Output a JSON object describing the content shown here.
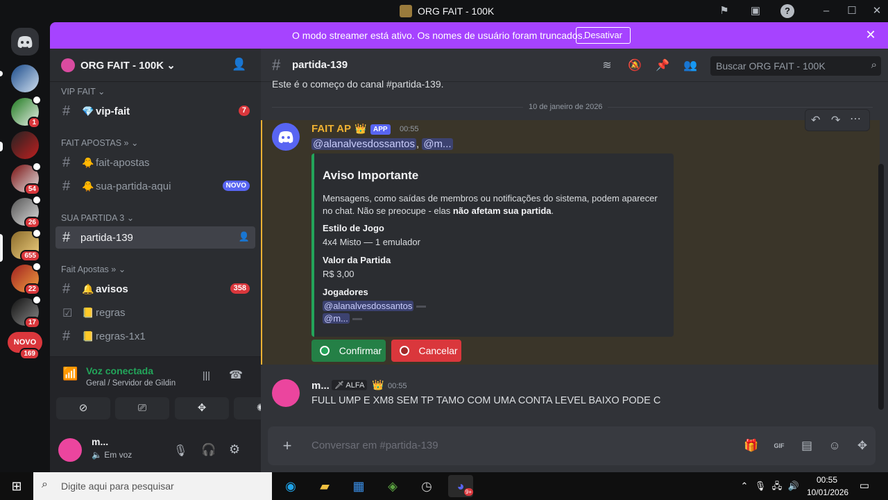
{
  "window": {
    "title": "ORG FAIT - 100K"
  },
  "banner": {
    "text": "O modo streamer está ativo. Os nomes de usuário foram truncados.",
    "button": "Desativar"
  },
  "servers": [
    {
      "badge": ""
    },
    {
      "badge": "1"
    },
    {
      "badge": ""
    },
    {
      "badge": "54"
    },
    {
      "badge": "26"
    },
    {
      "badge": "655"
    },
    {
      "badge": "22"
    },
    {
      "badge": "17"
    },
    {
      "label": "NOVO",
      "badge": "169"
    }
  ],
  "sidebar": {
    "guild_name": "ORG FAIT - 100K",
    "categories": [
      "VIP FAIT",
      "FAIT APOSTAS »",
      "SUA PARTIDA 3",
      "Fait Apostas »"
    ],
    "channels": [
      {
        "name": "vip-fait",
        "emoji": "💎",
        "count": "7"
      },
      {
        "name": "fait-apostas",
        "emoji": "🐥"
      },
      {
        "name": "sua-partida-aqui",
        "emoji": "🐥",
        "tag": "NOVO"
      },
      {
        "name": "partida-139"
      },
      {
        "name": "avisos",
        "emoji": "🔔",
        "count": "358"
      },
      {
        "name": "regras",
        "emoji": "📒"
      },
      {
        "name": "regras-1x1",
        "emoji": "📒"
      }
    ]
  },
  "voice": {
    "title": "Voz conectada",
    "subtitle": "Geral / Servidor de Gildin"
  },
  "user": {
    "name": "m...",
    "status": "Em voz"
  },
  "channel": {
    "name": "partida-139",
    "start_text": "Este é o começo do canal #partida-139.",
    "date_divider": "10 de janeiro de 2026",
    "search_placeholder": "Buscar ORG FAIT - 100K"
  },
  "message1": {
    "author": "FAIT AP",
    "tag": "APP",
    "time": "00:55",
    "mention1": "@alanalvesdossantos",
    "sep": ",",
    "mention2": "@m...",
    "embed": {
      "title": "Aviso Importante",
      "desc_1": "Mensagens, como saídas de membros ou notificações do sistema, podem aparecer no chat. Não se preocupe - elas ",
      "desc_bold": "não afetam sua partida",
      "desc_end": ".",
      "fields": [
        {
          "name": "Estilo de Jogo",
          "value": "4x4 Misto — 1 emulador"
        },
        {
          "name": "Valor da Partida",
          "value": "R$ 3,00"
        },
        {
          "name": "Jogadores",
          "value1": "@alanalvesdossantos",
          "value2": "@m..."
        }
      ]
    },
    "buttons": {
      "confirm": "Confirmar",
      "cancel": "Cancelar"
    }
  },
  "message2": {
    "author": "m...",
    "role": "ALFA",
    "time": "00:55",
    "text": "FULL UMP E XM8 SEM TP TAMO COM UMA CONTA LEVEL BAIXO PODE C"
  },
  "composer": {
    "placeholder": "Conversar em #partida-139"
  },
  "taskbar": {
    "search_placeholder": "Digite aqui para pesquisar",
    "time": "00:55",
    "date": "10/01/2026",
    "app_badge": "9+"
  },
  "colors": {
    "accent": "#5865f2",
    "banner": "#a643ff",
    "online": "#23a55a",
    "danger": "#da373c",
    "highlight": "#f0b232"
  }
}
